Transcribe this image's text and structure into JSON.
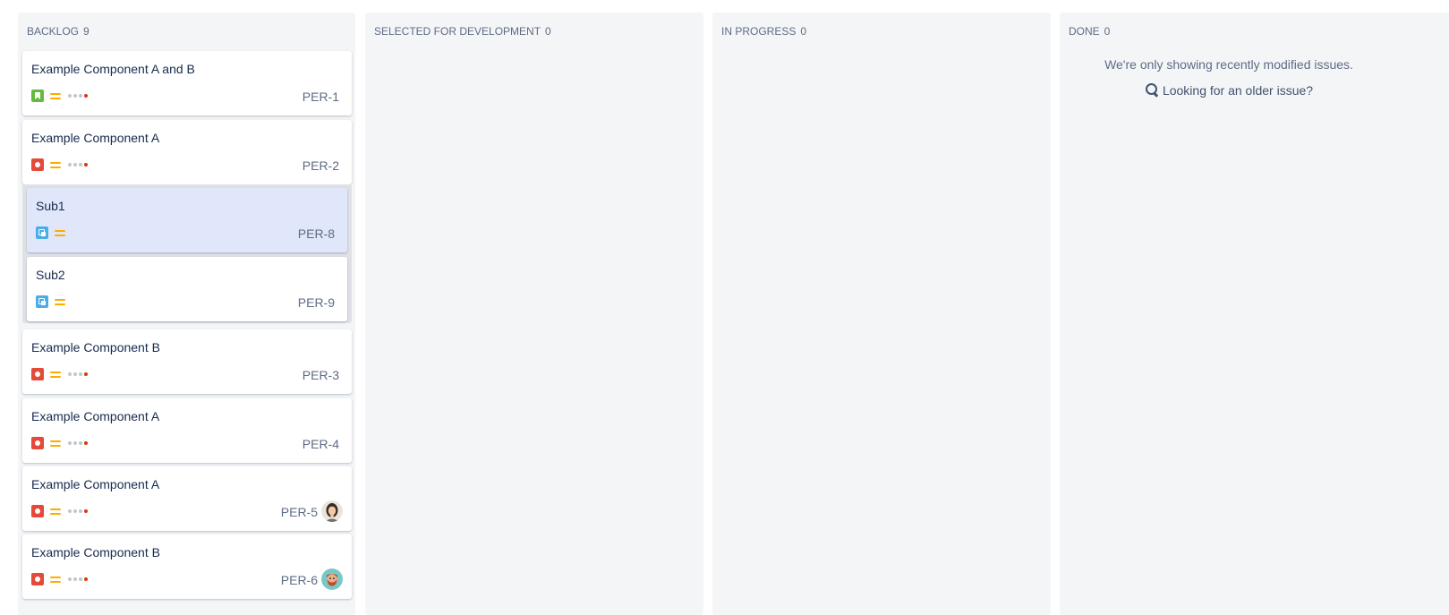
{
  "columns": [
    {
      "title": "BACKLOG",
      "count": "9"
    },
    {
      "title": "SELECTED FOR DEVELOPMENT",
      "count": "0"
    },
    {
      "title": "IN PROGRESS",
      "count": "0"
    },
    {
      "title": "DONE",
      "count": "0"
    }
  ],
  "backlog": {
    "cards": [
      {
        "summary": "Example Component A and B",
        "key": "PER-1",
        "type": "story-icon",
        "priority": "medium-priority-icon"
      },
      {
        "summary": "Example Component A",
        "key": "PER-2",
        "type": "bug-icon",
        "priority": "medium-priority-icon"
      },
      {
        "summary": "Example Component B",
        "key": "PER-3",
        "type": "bug-icon",
        "priority": "medium-priority-icon"
      },
      {
        "summary": "Example Component A",
        "key": "PER-4",
        "type": "bug-icon",
        "priority": "medium-priority-icon"
      },
      {
        "summary": "Example Component A",
        "key": "PER-5",
        "type": "bug-icon",
        "priority": "medium-priority-icon",
        "avatar": "woman-avatar"
      },
      {
        "summary": "Example Component B",
        "key": "PER-6",
        "type": "bug-icon",
        "priority": "medium-priority-icon",
        "avatar": "man-avatar"
      }
    ],
    "subtasks": [
      {
        "summary": "Sub1",
        "key": "PER-8",
        "type": "subtask-icon",
        "priority": "medium-priority-icon",
        "selected": true
      },
      {
        "summary": "Sub2",
        "key": "PER-9",
        "type": "subtask-icon",
        "priority": "medium-priority-icon",
        "selected": false
      }
    ]
  },
  "done": {
    "message": "We're only showing recently modified issues.",
    "link": "Looking for an older issue?",
    "link_icon": "search-icon"
  },
  "colors": {
    "column_bg": "#f4f5f7",
    "card_bg": "#ffffff",
    "selected_card_bg": "#e0e7fb",
    "bug": "#e5493a",
    "story": "#63ba3c",
    "subtask": "#4bade8",
    "priority_medium": "#ffab00"
  }
}
